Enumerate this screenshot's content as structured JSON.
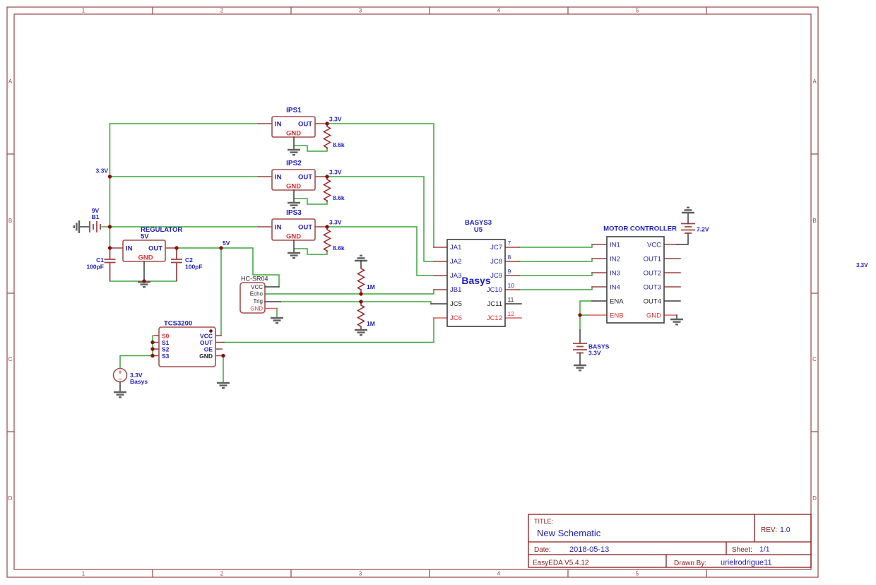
{
  "frame": {
    "top_numbers": [
      "1",
      "2",
      "3",
      "4",
      "5"
    ],
    "bottom_numbers": [
      "1",
      "2",
      "3",
      "4",
      "5"
    ],
    "left_letters": [
      "A",
      "B",
      "C",
      "D"
    ],
    "right_letters": [
      "A",
      "B",
      "C",
      "D"
    ]
  },
  "title_block": {
    "title_label": "TITLE:",
    "title": "New Schematic",
    "rev_label": "REV:",
    "rev": "1.0",
    "date_label": "Date:",
    "date": "2018-05-13",
    "sheet_label": "Sheet:",
    "sheet": "1/1",
    "software": "EasyEDA V5.4.12",
    "drawn_by_label": "Drawn By:",
    "drawn_by": "urielrodrigue11"
  },
  "nets": {
    "rail_33": "3.3V",
    "ips1_out": "3.3V",
    "ips2_out": "3.3V",
    "ips3_out": "3.3V",
    "v5": "5V",
    "stray_33": "3.3V"
  },
  "components": {
    "ips1": {
      "ref": "IPS1",
      "in": "IN",
      "out": "OUT",
      "gnd": "GND",
      "res": "8.6k"
    },
    "ips2": {
      "ref": "IPS2",
      "in": "IN",
      "out": "OUT",
      "gnd": "GND",
      "res": "8.6k"
    },
    "ips3": {
      "ref": "IPS3",
      "in": "IN",
      "out": "OUT",
      "gnd": "GND",
      "res": "8.6k"
    },
    "battery_9v": {
      "value": "9V",
      "ref": "B1"
    },
    "regulator": {
      "name": "REGULATOR",
      "value": "5V",
      "in": "IN",
      "out": "OUT",
      "gnd": "GND"
    },
    "c1": {
      "ref": "C1",
      "value": "100pF"
    },
    "c2": {
      "ref": "C2",
      "value": "100pF"
    },
    "hcsr04": {
      "name": "HC-SR04",
      "pins": [
        "VCC",
        "Echo",
        "Trig",
        "GND"
      ]
    },
    "r_upper": {
      "value": "1M"
    },
    "r_lower": {
      "value": "1M"
    },
    "tcs3200": {
      "name": "TCS3200",
      "left_pins": [
        "S0",
        "S1",
        "S2",
        "S3"
      ],
      "right_pins": [
        "VCC",
        "OUT",
        "OE",
        "GND"
      ]
    },
    "vsource": {
      "value": "3.3V",
      "label": "Basys",
      "plus": "+",
      "minus": "−"
    },
    "basys3": {
      "name": "BASYS3",
      "ref": "U5",
      "center_label": "Basys",
      "left_pins": [
        "JA1",
        "JA2",
        "JA3",
        "JB1",
        "JC5",
        "JC6"
      ],
      "right_pins": [
        "JC7",
        "JC8",
        "JC9",
        "JC10",
        "JC11",
        "JC12"
      ],
      "pin_numbers": [
        "7",
        "8",
        "9",
        "10",
        "11",
        "12"
      ]
    },
    "motor": {
      "name": "MOTOR CONTROLLER",
      "left_pins": [
        "IN1",
        "IN2",
        "IN3",
        "IN4",
        "ENA",
        "ENB"
      ],
      "right_pins": [
        "VCC",
        "OUT1",
        "OUT2",
        "OUT3",
        "OUT4",
        "GND"
      ]
    },
    "battery_72": {
      "value": "7.2V"
    },
    "battery_basys": {
      "ref": "BASYS",
      "value": "3.3V"
    }
  },
  "colors": {
    "wire_green": "#3aa63a",
    "frame": "#a05353",
    "title_lines": "#8b1a1a",
    "component_outline": "#a34f4f",
    "chip_outline": "#3d3d3d",
    "pin_blue": "#1d1dc9",
    "pin_red": "#e03333",
    "pin_black": "#1f1f1f",
    "stub_dark_red": "#9b4040",
    "stub_bright_red": "#e05a5a",
    "resistor": "#a02525",
    "junction": "#8c0f0f",
    "ground": "#5f5f5f",
    "battery": "#a04545"
  }
}
